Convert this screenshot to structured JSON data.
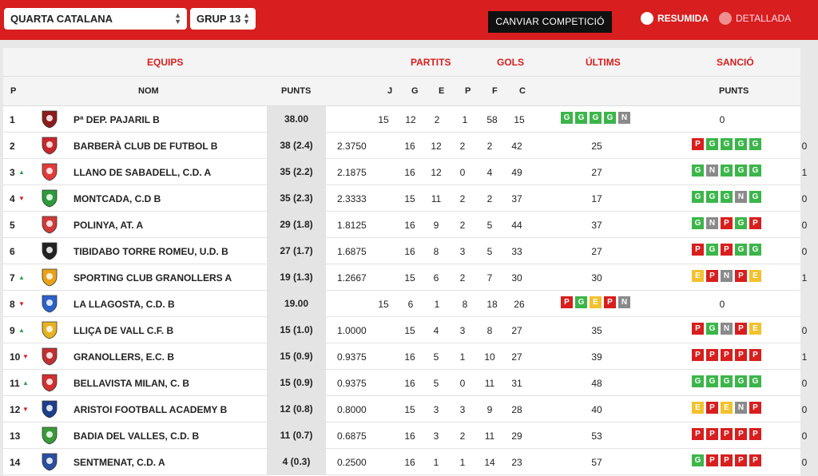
{
  "topbar": {
    "competition": "QUARTA CATALANA",
    "group": "GRUP 13",
    "change_button": "CANVIAR COMPETICIÓ",
    "view_resumida": "RESUMIDA",
    "view_detallada": "DETALLADA"
  },
  "headers": {
    "groups": {
      "equips": "EQUIPS",
      "partits": "PARTITS",
      "gols": "GOLS",
      "ultims": "ÚLTIMS",
      "sancio": "SANCIÓ"
    },
    "cols": {
      "p": "P",
      "nom": "NOM",
      "punts": "PUNTS",
      "j": "J",
      "g": "G",
      "e": "E",
      "pp": "P",
      "f": "F",
      "c": "C",
      "sancio_punts": "PUNTS"
    }
  },
  "colors": {
    "accent": "#d81e1e",
    "win": "#3cb54a",
    "draw": "#8a8a8a",
    "loss": "#d81e1e",
    "e": "#f2c12e"
  },
  "rows": [
    {
      "pos": "1",
      "trend": "",
      "name": "Pª DEP. PAJARIL B",
      "punts": "38.00",
      "ratio": "",
      "j": "15",
      "g": "12",
      "e": "2",
      "p": "1",
      "f": "58",
      "c": "15",
      "ultims": [
        "G",
        "G",
        "G",
        "G",
        "N"
      ],
      "sancio": "0",
      "crest": "#8c1c1c",
      "layout": "short"
    },
    {
      "pos": "2",
      "trend": "",
      "name": "BARBERÀ CLUB DE FUTBOL B",
      "punts": "38 (2.4)",
      "ratio": "2.3750",
      "j": "16",
      "g": "12",
      "e": "2",
      "p": "2",
      "f": "42",
      "c": "25",
      "ultims": [
        "P",
        "G",
        "G",
        "G",
        "G"
      ],
      "sancio": "0",
      "crest": "#c8282d",
      "layout": "long"
    },
    {
      "pos": "3",
      "trend": "up",
      "name": "LLANO DE SABADELL, C.D. A",
      "punts": "35 (2.2)",
      "ratio": "2.1875",
      "j": "16",
      "g": "12",
      "e": "0",
      "p": "4",
      "f": "49",
      "c": "27",
      "ultims": [
        "G",
        "N",
        "G",
        "G",
        "G"
      ],
      "sancio": "1",
      "crest": "#e23a3a",
      "layout": "long"
    },
    {
      "pos": "4",
      "trend": "down",
      "name": "MONTCADA, C.D B",
      "punts": "35 (2.3)",
      "ratio": "2.3333",
      "j": "15",
      "g": "11",
      "e": "2",
      "p": "2",
      "f": "37",
      "c": "17",
      "ultims": [
        "G",
        "G",
        "G",
        "N",
        "G"
      ],
      "sancio": "0",
      "crest": "#2d9a3c",
      "layout": "long"
    },
    {
      "pos": "5",
      "trend": "",
      "name": "POLINYA, AT. A",
      "punts": "29 (1.8)",
      "ratio": "1.8125",
      "j": "16",
      "g": "9",
      "e": "2",
      "p": "5",
      "f": "44",
      "c": "37",
      "ultims": [
        "G",
        "N",
        "P",
        "G",
        "P"
      ],
      "sancio": "0",
      "crest": "#d13a3a",
      "layout": "long"
    },
    {
      "pos": "6",
      "trend": "",
      "name": "TIBIDABO TORRE ROMEU, U.D. B",
      "punts": "27 (1.7)",
      "ratio": "1.6875",
      "j": "16",
      "g": "8",
      "e": "3",
      "p": "5",
      "f": "33",
      "c": "27",
      "ultims": [
        "P",
        "G",
        "P",
        "G",
        "G"
      ],
      "sancio": "0",
      "crest": "#222222",
      "layout": "long"
    },
    {
      "pos": "7",
      "trend": "up",
      "name": "SPORTING CLUB GRANOLLERS A",
      "punts": "19 (1.3)",
      "ratio": "1.2667",
      "j": "15",
      "g": "6",
      "e": "2",
      "p": "7",
      "f": "30",
      "c": "30",
      "ultims": [
        "E",
        "P",
        "N",
        "P",
        "E"
      ],
      "sancio": "1",
      "crest": "#e8a21a",
      "layout": "long"
    },
    {
      "pos": "8",
      "trend": "down",
      "name": "LA LLAGOSTA, C.D. B",
      "punts": "19.00",
      "ratio": "",
      "j": "15",
      "g": "6",
      "e": "1",
      "p": "8",
      "f": "18",
      "c": "26",
      "ultims": [
        "P",
        "G",
        "E",
        "P",
        "N"
      ],
      "sancio": "0",
      "crest": "#2a62c9",
      "layout": "short"
    },
    {
      "pos": "9",
      "trend": "up",
      "name": "LLIÇA DE VALL C.F. B",
      "punts": "15 (1.0)",
      "ratio": "1.0000",
      "j": "15",
      "g": "4",
      "e": "3",
      "p": "8",
      "f": "27",
      "c": "35",
      "ultims": [
        "P",
        "G",
        "N",
        "P",
        "E"
      ],
      "sancio": "0",
      "crest": "#e6b422",
      "layout": "long"
    },
    {
      "pos": "10",
      "trend": "down",
      "name": "GRANOLLERS, E.C. B",
      "punts": "15 (0.9)",
      "ratio": "0.9375",
      "j": "16",
      "g": "5",
      "e": "1",
      "p": "10",
      "f": "27",
      "c": "39",
      "ultims": [
        "P",
        "P",
        "P",
        "P",
        "P"
      ],
      "sancio": "1",
      "crest": "#c03030",
      "layout": "long"
    },
    {
      "pos": "11",
      "trend": "up",
      "name": "BELLAVISTA MILAN, C. B",
      "punts": "15 (0.9)",
      "ratio": "0.9375",
      "j": "16",
      "g": "5",
      "e": "0",
      "p": "11",
      "f": "31",
      "c": "48",
      "ultims": [
        "G",
        "G",
        "G",
        "G",
        "G"
      ],
      "sancio": "0",
      "crest": "#d13030",
      "layout": "long"
    },
    {
      "pos": "12",
      "trend": "down",
      "name": "ARISTOI FOOTBALL ACADEMY B",
      "punts": "12 (0.8)",
      "ratio": "0.8000",
      "j": "15",
      "g": "3",
      "e": "3",
      "p": "9",
      "f": "28",
      "c": "40",
      "ultims": [
        "E",
        "P",
        "E",
        "N",
        "P"
      ],
      "sancio": "0",
      "crest": "#1d3f8a",
      "layout": "long"
    },
    {
      "pos": "13",
      "trend": "",
      "name": "BADIA DEL VALLES, C.D. B",
      "punts": "11 (0.7)",
      "ratio": "0.6875",
      "j": "16",
      "g": "3",
      "e": "2",
      "p": "11",
      "f": "29",
      "c": "53",
      "ultims": [
        "P",
        "P",
        "P",
        "P",
        "P"
      ],
      "sancio": "0",
      "crest": "#3a9a3a",
      "layout": "long"
    },
    {
      "pos": "14",
      "trend": "",
      "name": "SENTMENAT, C.D. A",
      "punts": "4 (0.3)",
      "ratio": "0.2500",
      "j": "16",
      "g": "1",
      "e": "1",
      "p": "14",
      "f": "23",
      "c": "57",
      "ultims": [
        "G",
        "P",
        "P",
        "P",
        "P"
      ],
      "sancio": "0",
      "crest": "#2a4fa0",
      "layout": "long"
    }
  ]
}
